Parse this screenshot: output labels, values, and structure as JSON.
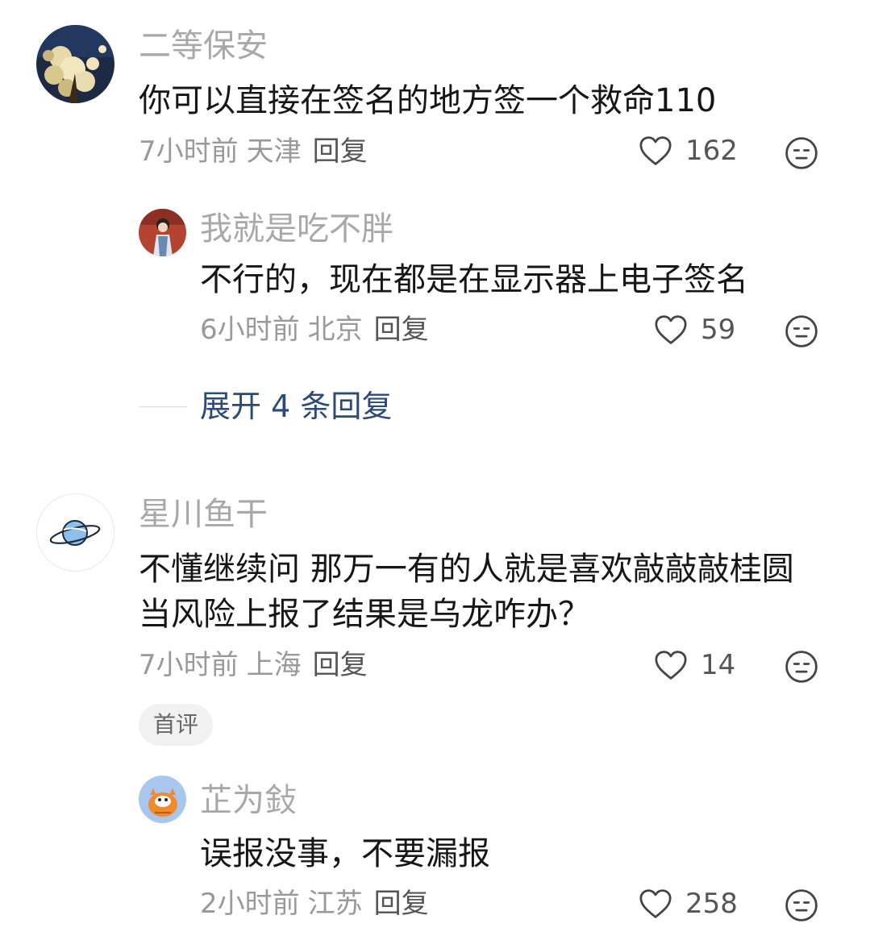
{
  "comments": [
    {
      "username": "二等保安",
      "avatar": "flower-tree-night-avatar",
      "text": "你可以直接在签名的地方签一个救命110",
      "time": "7小时前",
      "location": "天津",
      "reply_label": "回复",
      "likes": "162",
      "replies": [
        {
          "username": "我就是吃不胖",
          "avatar": "person-portrait-avatar",
          "text": "不行的，现在都是在显示器上电子签名",
          "time": "6小时前",
          "location": "北京",
          "reply_label": "回复",
          "likes": "59"
        }
      ],
      "expand_label": "展开 4 条回复"
    },
    {
      "username": "星川鱼干",
      "avatar": "planet-avatar",
      "text_lines": [
        "不懂继续问 那万一有的人就是喜欢敲敲敲桂圆",
        "当风险上报了结果是乌龙咋办？"
      ],
      "time": "7小时前",
      "location": "上海",
      "reply_label": "回复",
      "likes": "14",
      "badge": "首评",
      "replies": [
        {
          "username": "芷为鈙",
          "avatar": "cartoon-cat-avatar",
          "text": "误报没事，不要漏报",
          "time": "2小时前",
          "location": "江苏",
          "reply_label": "回复",
          "likes": "258"
        }
      ]
    }
  ],
  "colors": {
    "username": "#a8a8a8",
    "text": "#161616",
    "meta": "#999999",
    "expand": "#2b4a75",
    "badge_bg": "#f1f1f1"
  }
}
